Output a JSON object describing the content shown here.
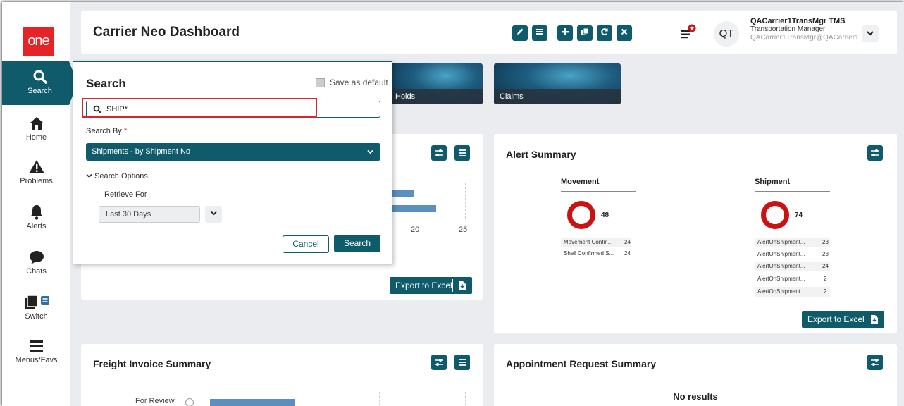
{
  "app": {
    "logo_text": "one",
    "title": "Carrier Neo Dashboard"
  },
  "sidebar": {
    "items": [
      {
        "label": "Search",
        "icon": "search-icon"
      },
      {
        "label": "Home",
        "icon": "home-icon"
      },
      {
        "label": "Problems",
        "icon": "warning-icon"
      },
      {
        "label": "Alerts",
        "icon": "bell-icon"
      },
      {
        "label": "Chats",
        "icon": "chat-icon"
      },
      {
        "label": "Switch",
        "icon": "switch-icon"
      },
      {
        "label": "Menus/Favs",
        "icon": "menu-icon"
      }
    ]
  },
  "user": {
    "initials": "QT",
    "name": "QACarrier1TransMgr TMS",
    "role": "Transportation Manager",
    "email": "QACarrier1TransMgr@QACarrier1"
  },
  "tiles": [
    {
      "label": "Holds"
    },
    {
      "label": "Claims"
    }
  ],
  "left_card": {
    "axis_ticks": [
      "20",
      "25"
    ],
    "export_label": "Export to Excel"
  },
  "alert_summary": {
    "title": "Alert Summary",
    "movement": {
      "heading": "Movement",
      "count": "48",
      "rows": [
        {
          "label": "Movement Confir...",
          "value": "24"
        },
        {
          "label": "Shell Confirmed S...",
          "value": "24"
        }
      ]
    },
    "shipment": {
      "heading": "Shipment",
      "count": "74",
      "rows": [
        {
          "label": "AlertOnShipment...",
          "value": "23"
        },
        {
          "label": "AlertOnShipment...",
          "value": "23"
        },
        {
          "label": "AlertOnShipment...",
          "value": "24"
        },
        {
          "label": "AlertOnShipment...",
          "value": "2"
        },
        {
          "label": "AlertOnShipment...",
          "value": "2"
        }
      ]
    },
    "export_label": "Export to Excel"
  },
  "freight_invoice": {
    "title": "Freight Invoice Summary",
    "row_label": "For Review"
  },
  "appointment": {
    "title": "Appointment Request Summary",
    "empty": "No results"
  },
  "search_panel": {
    "title": "Search",
    "save_default": "Save as default",
    "input_value": "SHIP*",
    "search_by_label": "Search By",
    "required_mark": "*",
    "search_by_value": "Shipments - by Shipment No",
    "options_label": "Search Options",
    "retrieve_label": "Retrieve For",
    "retrieve_value": "Last 30 Days",
    "cancel": "Cancel",
    "submit": "Search"
  },
  "colors": {
    "primary": "#0f5b6b",
    "brand_red": "#e52428",
    "ring_red": "#cc1111",
    "highlight": "#d9262b"
  }
}
